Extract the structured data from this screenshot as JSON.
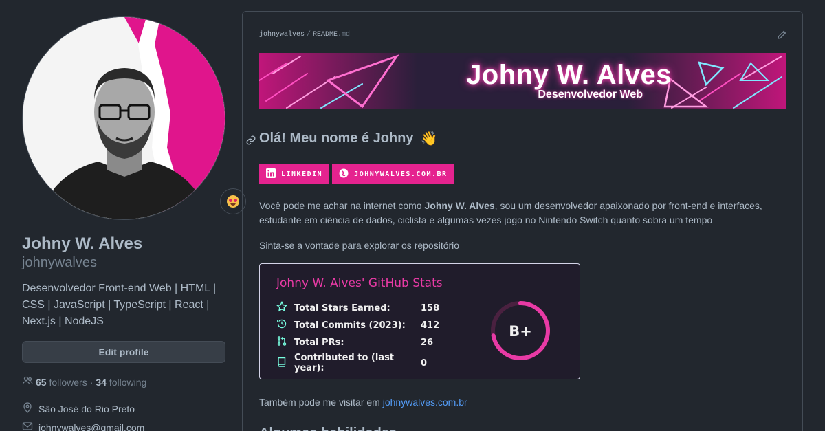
{
  "profile": {
    "fullname": "Johny W. Alves",
    "username": "johnywalves",
    "bio": "Desenvolvedor Front-end Web | HTML | CSS | JavaScript | TypeScript | React | Next.js | NodeJS",
    "edit_button": "Edit profile",
    "followers_count": "65",
    "followers_label": "followers",
    "separator": "·",
    "following_count": "34",
    "following_label": "following",
    "location": "São José do Rio Preto",
    "email": "johnywalves@gmail.com",
    "status_emoji": "star-struck-emoji"
  },
  "readme": {
    "owner": "johnywalves",
    "path_sep": "/",
    "file": "README",
    "ext": ".md",
    "banner_title": "Johny W. Alves",
    "banner_subtitle": "Desenvolvedor Web",
    "heading": "Olá! Meu nome é Johny",
    "heading_emoji": "👋",
    "badges": [
      {
        "label": "LINKEDIN",
        "icon": "linkedin-icon"
      },
      {
        "label": "JOHNYWALVES.COM.BR",
        "icon": "globe-icon"
      }
    ],
    "intro_before": "Você pode me achar na internet como ",
    "intro_bold": "Johny W. Alves",
    "intro_after": ", sou um desenvolvedor apaixonado por front-end e interfaces, estudante em ciência de dados, ciclista e algumas vezes jogo no Nintendo Switch quanto sobra um tempo",
    "explore": "Sinta-se a vontade para explorar os repositório",
    "visit_before": "Também pode me visitar em ",
    "visit_link": "johnywalves.com.br",
    "next_heading": "Algumas habilidades"
  },
  "stats": {
    "title": "Johny W. Alves' GitHub Stats",
    "rows": [
      {
        "label": "Total Stars Earned:",
        "value": "158",
        "icon": "star-icon"
      },
      {
        "label": "Total Commits (2023):",
        "value": "412",
        "icon": "history-icon"
      },
      {
        "label": "Total PRs:",
        "value": "26",
        "icon": "pull-request-icon"
      },
      {
        "label": "Contributed to (last year):",
        "value": "0",
        "icon": "repo-icon"
      }
    ],
    "grade": "B+",
    "grade_progress": 0.72
  },
  "colors": {
    "accent_pink": "#e5238f",
    "stats_title": "#e83aa5",
    "stats_icon": "#79ffe1",
    "link": "#539bf5",
    "background": "#22272e"
  }
}
